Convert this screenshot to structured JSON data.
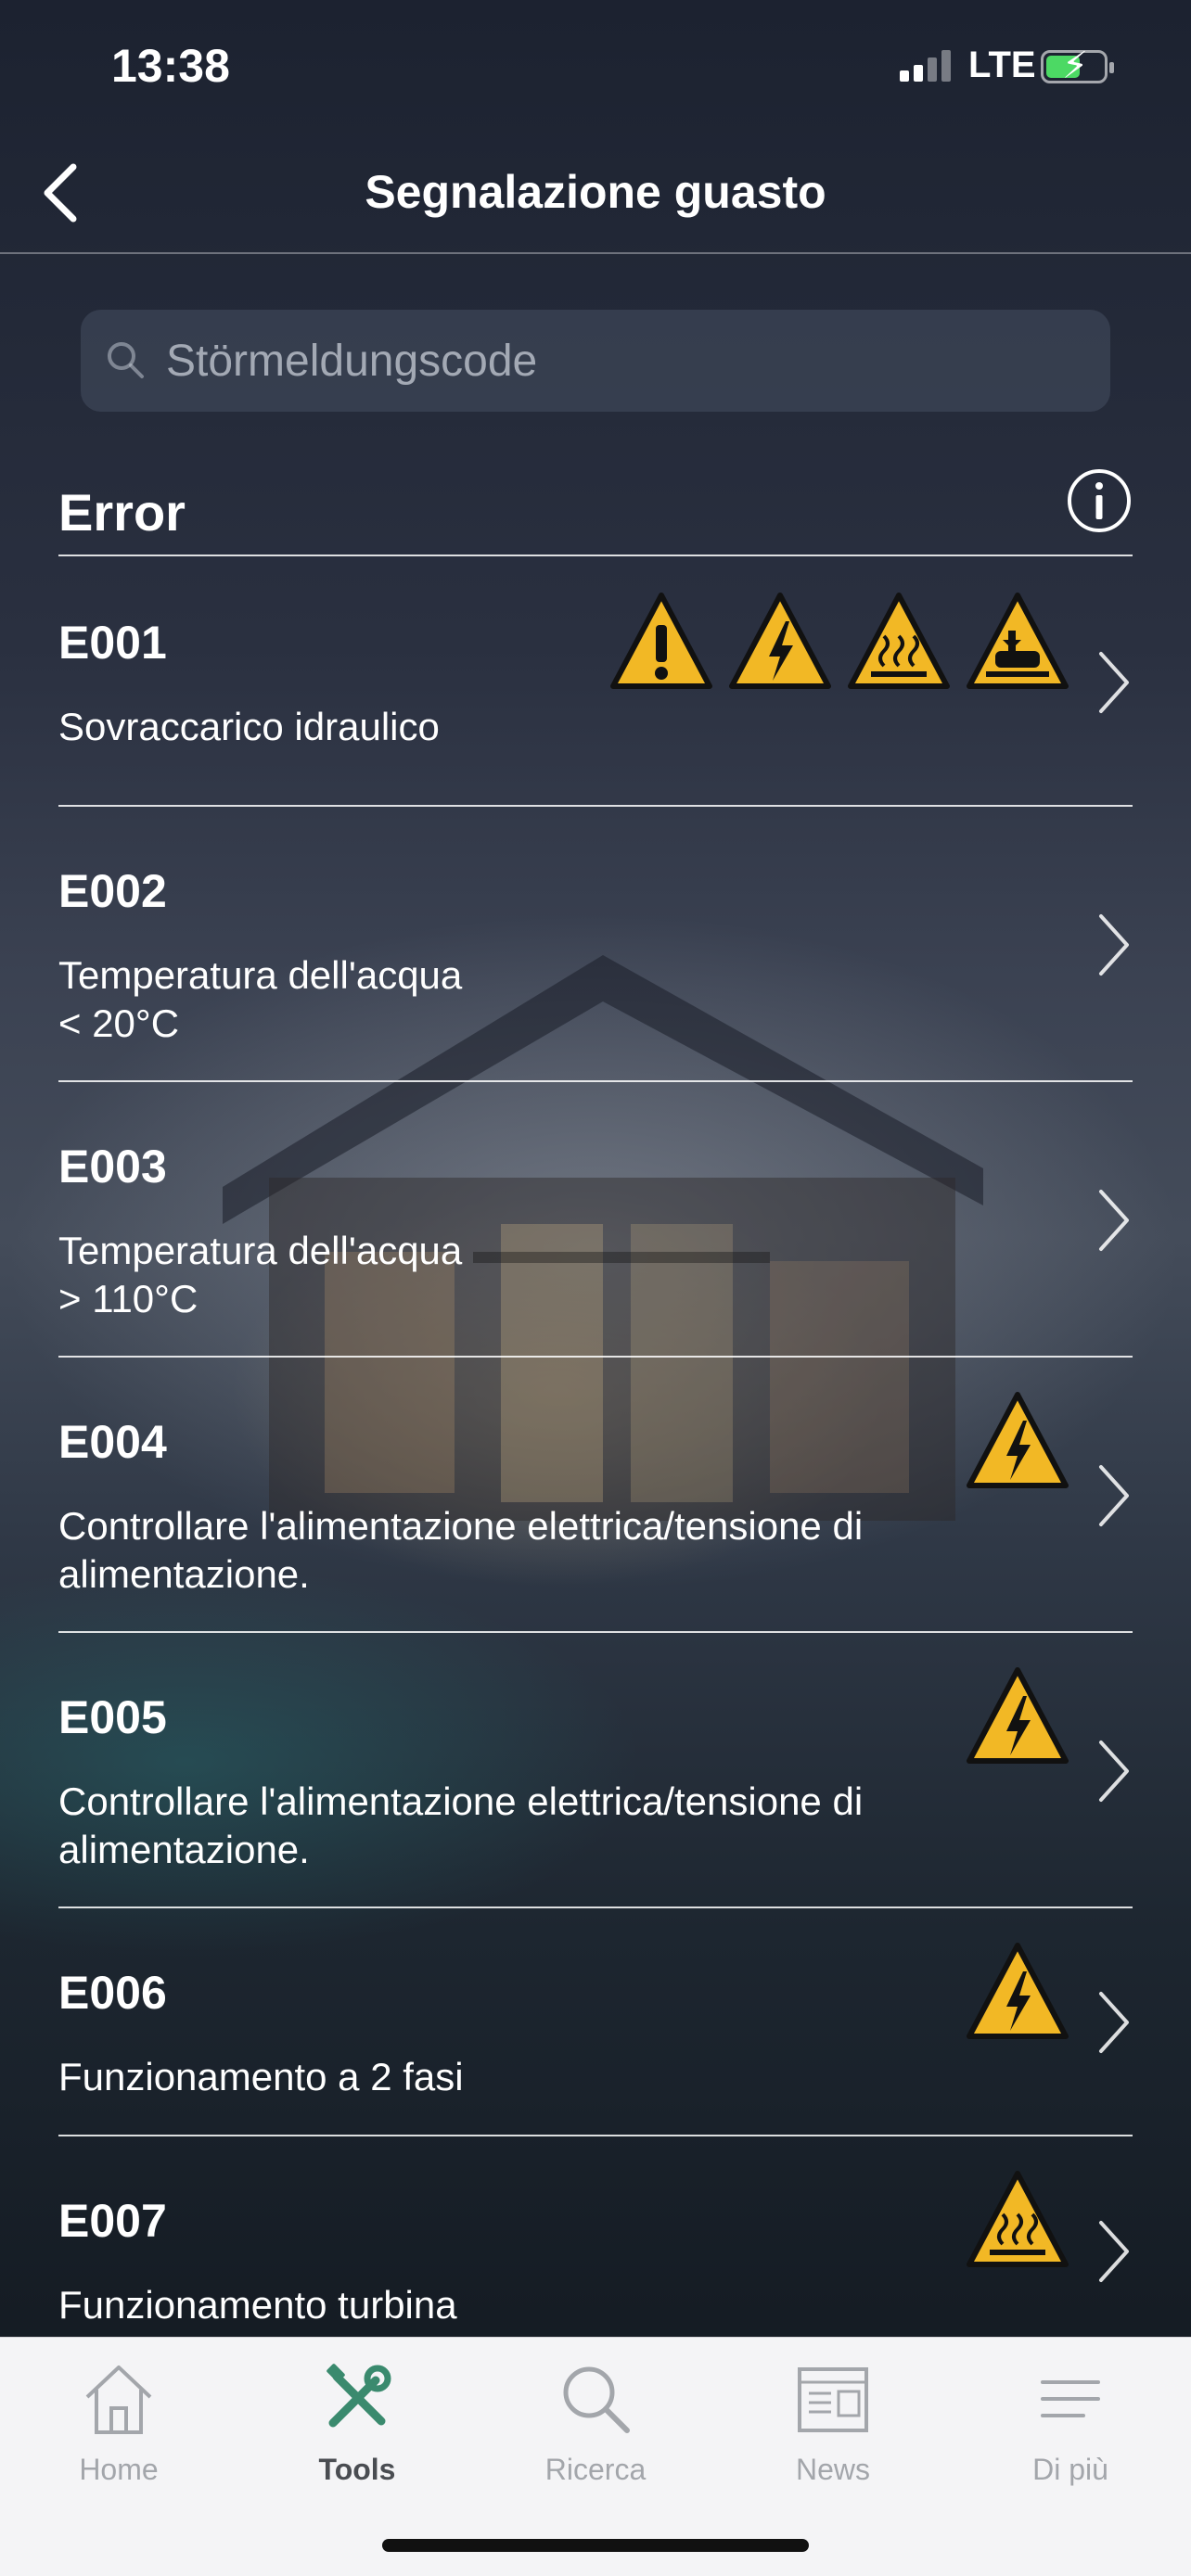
{
  "status_bar": {
    "time": "13:38",
    "network": "LTE"
  },
  "nav": {
    "title": "Segnalazione guasto",
    "back_icon": "chevron-left-icon"
  },
  "search": {
    "placeholder": "Störmeldungscode",
    "value": ""
  },
  "section": {
    "title": "Error",
    "info_icon": "info-circle-icon"
  },
  "colors": {
    "warning_yellow": "#f2b825",
    "tab_active": "#3a8a6e",
    "tab_inactive": "#a3a6ab"
  },
  "errors": [
    {
      "code": "E001",
      "description": "Sovraccarico idraulico",
      "warnings": [
        "general-warning-icon",
        "electric-hazard-icon",
        "hot-surface-icon",
        "hand-crush-hazard-icon"
      ]
    },
    {
      "code": "E002",
      "description": "Temperatura dell'acqua\n < 20°C",
      "warnings": []
    },
    {
      "code": "E003",
      "description": "Temperatura dell'acqua\n> 110°C",
      "warnings": []
    },
    {
      "code": "E004",
      "description": "Controllare l'alimentazione elettrica/tensione di alimentazione.",
      "warnings": [
        "electric-hazard-icon"
      ]
    },
    {
      "code": "E005",
      "description": "Controllare l'alimentazione elettrica/tensione di alimentazione.",
      "warnings": [
        "electric-hazard-icon"
      ]
    },
    {
      "code": "E006",
      "description": "Funzionamento a 2 fasi",
      "warnings": [
        "electric-hazard-icon"
      ]
    },
    {
      "code": "E007",
      "description": "Funzionamento turbina",
      "warnings": [
        "hot-surface-icon"
      ]
    }
  ],
  "tab_bar": {
    "tabs": [
      {
        "label": "Home",
        "icon": "home-icon",
        "active": false
      },
      {
        "label": "Tools",
        "icon": "tools-icon",
        "active": true
      },
      {
        "label": "Ricerca",
        "icon": "search-icon",
        "active": false
      },
      {
        "label": "News",
        "icon": "newspaper-icon",
        "active": false
      },
      {
        "label": "Di più",
        "icon": "menu-icon",
        "active": false
      }
    ]
  }
}
